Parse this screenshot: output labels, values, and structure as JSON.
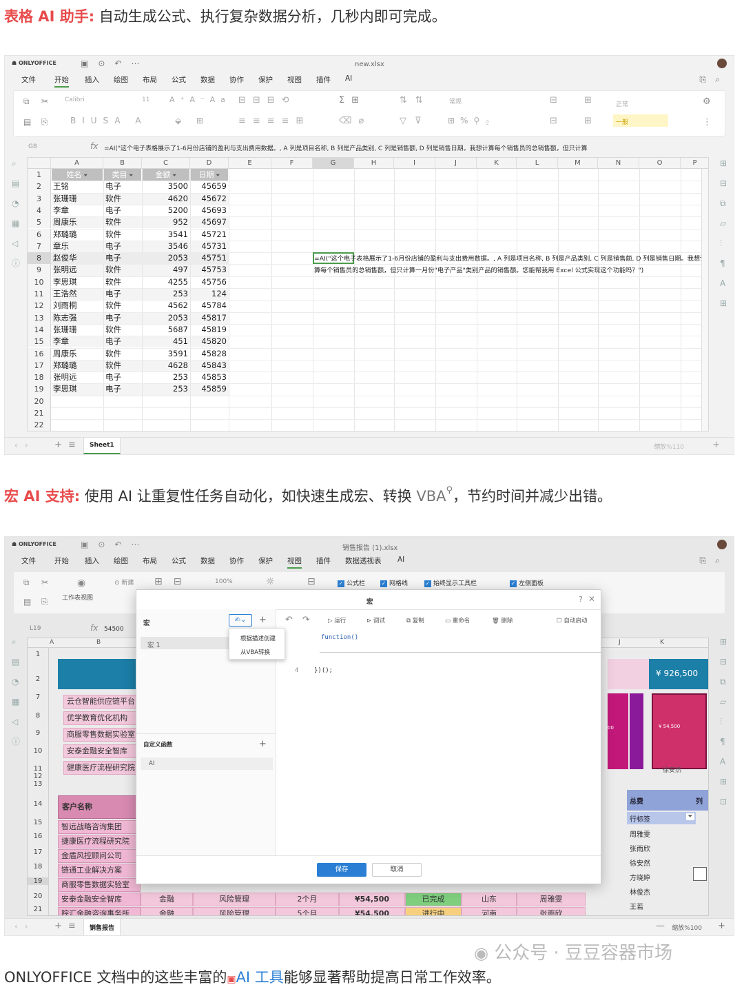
{
  "section1": {
    "highlight": "表格 AI 助手:",
    "text": "自动生成公式、执行复杂数据分析，几秒内即可完成。"
  },
  "shot1": {
    "brand": "ONLYOFFICE",
    "filename": "new.xlsx",
    "menu": [
      "文件",
      "开始",
      "插入",
      "绘图",
      "布局",
      "公式",
      "数据",
      "协作",
      "保护",
      "视图",
      "插件",
      "AI"
    ],
    "font_name": "Calibri",
    "font_size": "11",
    "number_format": "常规",
    "style_label": "正常",
    "style_label2": "一般",
    "namebox": "G8",
    "fx": "fx",
    "formula": "=AI(\"这个电子表格展示了1-6月份店铺的盈利与支出费用数据。, A 列是项目名称, B 列是产品类别, C 列是销售额, D 列是销售日期。我想计算每个销售员的总销售额，但只计算",
    "columns": [
      "A",
      "B",
      "C",
      "D",
      "E",
      "F",
      "G",
      "H",
      "I",
      "J",
      "K",
      "L",
      "M",
      "N",
      "O",
      "P"
    ],
    "headers": [
      "姓名",
      "类目",
      "金额",
      "日期"
    ],
    "rows": [
      [
        "王铭",
        "电子",
        "3500",
        "45659"
      ],
      [
        "张珊珊",
        "软件",
        "4620",
        "45672"
      ],
      [
        "李章",
        "电子",
        "5200",
        "45693"
      ],
      [
        "周康乐",
        "软件",
        "952",
        "45697"
      ],
      [
        "郑璐璐",
        "软件",
        "3541",
        "45721"
      ],
      [
        "章乐",
        "电子",
        "3546",
        "45731"
      ],
      [
        "赵俊华",
        "电子",
        "2053",
        "45751"
      ],
      [
        "张明远",
        "软件",
        "497",
        "45753"
      ],
      [
        "李思琪",
        "软件",
        "4255",
        "45756"
      ],
      [
        "王浩然",
        "电子",
        "253",
        "124"
      ],
      [
        "刘雨桐",
        "软件",
        "4562",
        "45784"
      ],
      [
        "陈志强",
        "电子",
        "2053",
        "45817"
      ],
      [
        "张珊珊",
        "软件",
        "5687",
        "45819"
      ],
      [
        "李章",
        "电子",
        "451",
        "45820"
      ],
      [
        "周康乐",
        "软件",
        "3591",
        "45828"
      ],
      [
        "郑璐璐",
        "软件",
        "4628",
        "45843"
      ],
      [
        "张明远",
        "电子",
        "253",
        "45853"
      ],
      [
        "李思琪",
        "电子",
        "253",
        "45859"
      ]
    ],
    "row_numbers": [
      "1",
      "2",
      "3",
      "4",
      "5",
      "6",
      "7",
      "8",
      "9",
      "10",
      "11",
      "12",
      "13",
      "14",
      "15",
      "16",
      "17",
      "18",
      "19",
      "20",
      "21",
      "22"
    ],
    "cell_text": "=AI(\"这个电子表格展示了1-6月份店铺的盈利与支出费用数据。, A 列是项目名称, B 列是产品类别, C 列是销售额, D 列是销售日期。我想计算每个销售员的总销售额，但只计算一月份\"电子产品\"类别产品的销售额。您能帮我用 Excel 公式实现这个功能吗？\")",
    "sheet": "Sheet1",
    "zoom": "缩放%110"
  },
  "section2": {
    "highlight": "宏 AI 支持:",
    "text1": "使用 AI 让重复性任务自动化，如快速生成宏、转换 ",
    "vba": "VBA",
    "text2": "，节约时间并减少出错。"
  },
  "shot2": {
    "brand": "ONLYOFFICE",
    "filename": "销售报告 (1).xlsx",
    "menu": [
      "文件",
      "开始",
      "插入",
      "绘图",
      "布局",
      "公式",
      "数据",
      "协作",
      "保护",
      "视图",
      "插件",
      "数据透视表",
      "AI"
    ],
    "view_label": "工作表视图",
    "new_label": "新建",
    "zoom_sel": "100%",
    "checks": [
      "公式栏",
      "网格线",
      "始终显示工具栏",
      "左侧面板"
    ],
    "namebox": "L19",
    "fx": "fx",
    "formula": "54500",
    "dialog": {
      "title": "宏",
      "macro_header": "宏",
      "macro_item": "宏 1",
      "dropdown": [
        "根据描述创建",
        "从VBA转换"
      ],
      "toolbar": [
        "运行",
        "调试",
        "复制",
        "重命名",
        "删除"
      ],
      "autostart": "自动启动",
      "code1": "function()",
      "line_no": "4",
      "code2": "})();",
      "custom_funcs": "自定义函数",
      "func_item": "AI",
      "save": "保存",
      "cancel": "取消"
    },
    "left_cells": [
      "云仓智能供应链平台",
      "优学教育优化机构",
      "商服零售数据实验室",
      "安泰金融安全智库",
      "健康医疗流程研究院"
    ],
    "cust_header": "客户名称",
    "customers": [
      "智远战略咨询集团",
      "捷康医疗流程研究院",
      "金盾风控顾问公司",
      "链通工业解决方案",
      "商服零售数据实验室",
      "安泰金融安全智库",
      "踪汇金融咨询事务所"
    ],
    "row20": [
      "金融",
      "风险管理",
      "2个月",
      "¥54,500",
      "已完成",
      "山东",
      "周雅雯"
    ],
    "row21": [
      "金融",
      "风险管理",
      "5个月",
      "¥54,500",
      "进行中",
      "河南",
      "张雨欣"
    ],
    "big_value": "¥ 926,500",
    "small_value": "¥ 54,500",
    "pink_value": "00",
    "name_label": "徐安然",
    "pivot_h1": "总费",
    "pivot_h2": "列",
    "pivot_row": "行标签",
    "pivot_names": [
      "周雅雯",
      "张雨欣",
      "徐安然",
      "方晓婷",
      "林俊杰",
      "王若"
    ],
    "rows_left": [
      "1",
      "2",
      "7",
      "8",
      "9",
      "10",
      "11",
      "12",
      "13",
      "14",
      "15",
      "16",
      "17",
      "18",
      "19",
      "20",
      "21"
    ],
    "cols": [
      "A",
      "B",
      "J",
      "K"
    ],
    "sheet": "销售报告",
    "zoom": "缩放%100"
  },
  "watermark": "公众号 · 豆豆容器市场",
  "footer": {
    "t1": "ONLYOFFICE 文档中的这些丰富的",
    "link": "AI 工具",
    "t2": "能够显著帮助提高日常工作效率。"
  },
  "colors": {
    "accent": "#e84b4b",
    "green": "#4a9b4a",
    "blue": "#2a7fd4",
    "magenta": "#c2187a",
    "pink": "#f3c8dc",
    "teal": "#1b7fa8"
  }
}
